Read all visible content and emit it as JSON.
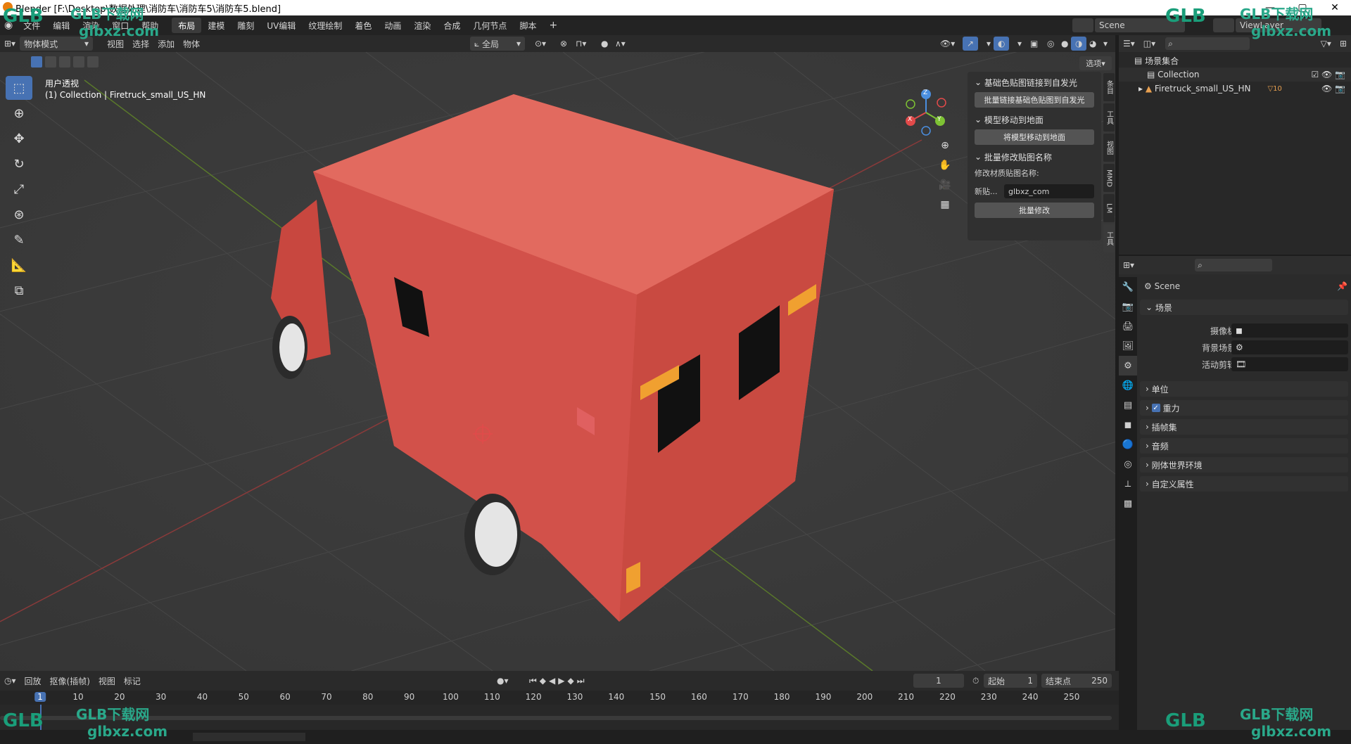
{
  "window": {
    "title": "Blender [F:\\Desktop\\数据处理\\消防车\\消防车5\\消防车5.blend]"
  },
  "topbar": {
    "menus": [
      "文件",
      "编辑",
      "渲染",
      "窗口",
      "帮助"
    ],
    "workspaces": [
      "布局",
      "建模",
      "雕刻",
      "UV编辑",
      "纹理绘制",
      "着色",
      "动画",
      "渲染",
      "合成",
      "几何节点",
      "脚本"
    ],
    "active_workspace": "布局",
    "scene_name": "Scene",
    "view_layer": "ViewLayer"
  },
  "viewport_header": {
    "mode": "物体模式",
    "menus": [
      "视图",
      "选择",
      "添加",
      "物体"
    ],
    "orientation": "全局",
    "options": "选项"
  },
  "viewport": {
    "view_name": "用户透视",
    "collection_info": "(1) Collection | Firetruck_small_US_HN",
    "gizmo": {
      "x": "X",
      "y": "Y",
      "z": "Z"
    }
  },
  "npanel": {
    "sec1_title": "基础色贴图链接到自发光",
    "sec1_btn": "批量链接基础色贴图到自发光",
    "sec2_title": "模型移动到地面",
    "sec2_btn": "将模型移动到地面",
    "sec3_title": "批量修改贴图名称",
    "sec3_label": "修改材质贴图名称:",
    "new_label": "新贴...",
    "new_value": "glbxz_com",
    "sec3_btn": "批量修改",
    "tabs": [
      "条目",
      "工具",
      "视图",
      "MMD",
      "LM",
      "工具"
    ]
  },
  "outliner": {
    "root": "场景集合",
    "items": [
      {
        "label": "Collection"
      },
      {
        "label": "Firetruck_small_US_HN",
        "badge": "10"
      }
    ]
  },
  "properties": {
    "header": "Scene",
    "section_scene": "场景",
    "camera_label": "摄像机",
    "bg_label": "背景场景",
    "clip_label": "活动剪辑",
    "sections": [
      "单位",
      "重力",
      "插帧集",
      "音频",
      "刚体世界环境",
      "自定义属性"
    ]
  },
  "timeline": {
    "menus": [
      "回放",
      "抠像(插帧)",
      "视图",
      "标记"
    ],
    "current_frame": "1",
    "start_label": "起始",
    "start": "1",
    "end_label": "结束点",
    "end": "250",
    "ticks": [
      "1",
      "10",
      "20",
      "30",
      "40",
      "50",
      "60",
      "70",
      "80",
      "90",
      "100",
      "110",
      "120",
      "130",
      "140",
      "150",
      "160",
      "170",
      "180",
      "190",
      "200",
      "210",
      "220",
      "230",
      "240",
      "250"
    ]
  },
  "watermark": {
    "brand": "GLB下载网",
    "site": "glbxz.com",
    "logo": "GLB"
  }
}
